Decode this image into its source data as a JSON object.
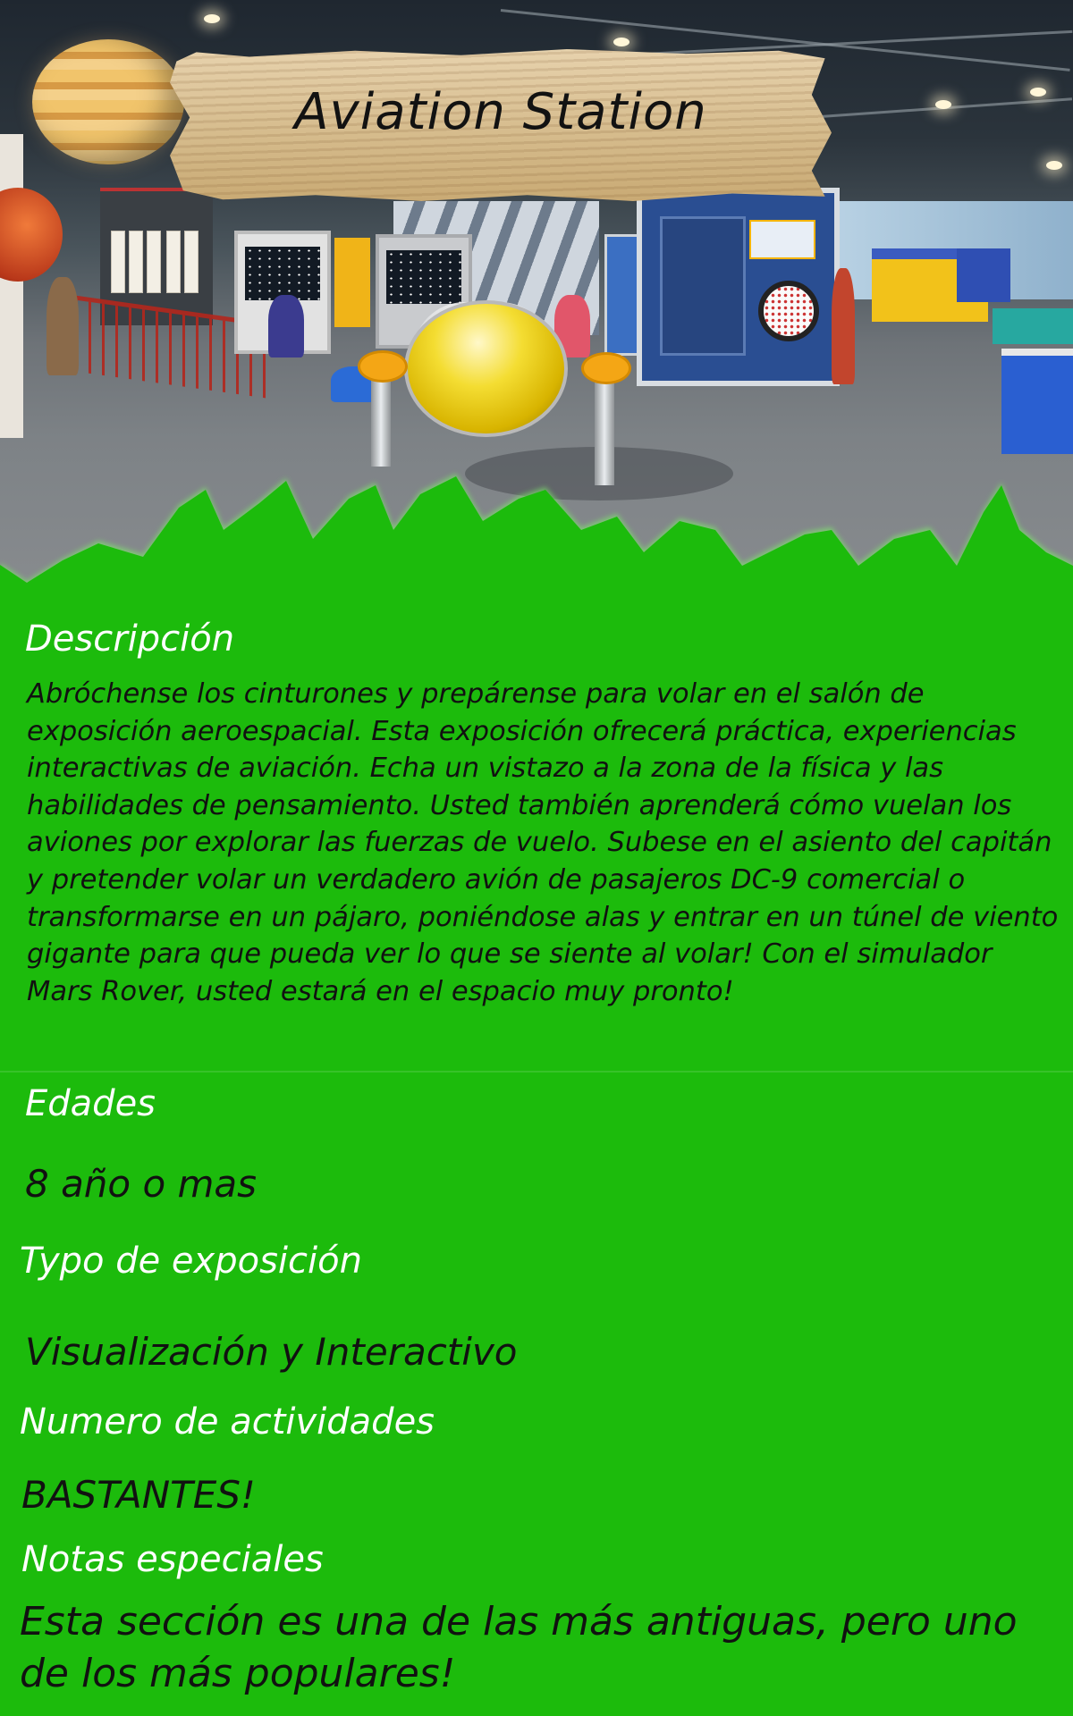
{
  "sign": {
    "title": "Aviation Station"
  },
  "description": {
    "heading": "Descripción",
    "body": "Abróchense los cinturones y prepárense para volar en el salón de exposición aeroespacial. Esta exposición ofrecerá práctica, experiencias interactivas de aviación. Echa un vistazo a la zona de la física y las habilidades de pensamiento. Usted también aprenderá cómo vuelan los aviones por explorar las fuerzas de vuelo. Subese en el asiento del capitán y pretender volar un verdadero avión de pasajeros DC-9 comercial o transformarse en un pájaro, poniéndose alas y entrar en un túnel de viento gigante para que pueda ver lo que se siente al volar! Con el simulador Mars Rover, usted estará en el espacio muy pronto!"
  },
  "ages": {
    "heading": "Edades",
    "value": "8 año o mas"
  },
  "exhibit_type": {
    "heading": "Typo de exposición",
    "value": "Visualización y Interactivo"
  },
  "activities": {
    "heading": "Numero de actividades",
    "value": "BASTANTES!"
  },
  "notes": {
    "heading": "Notas especiales",
    "value": "Esta sección es una de las más antiguas, pero uno de los más populares!"
  },
  "colors": {
    "background": "#1cbb0c",
    "heading_text": "#ffffff",
    "body_text": "#111111",
    "sign_wood": "#d6bc8d"
  }
}
